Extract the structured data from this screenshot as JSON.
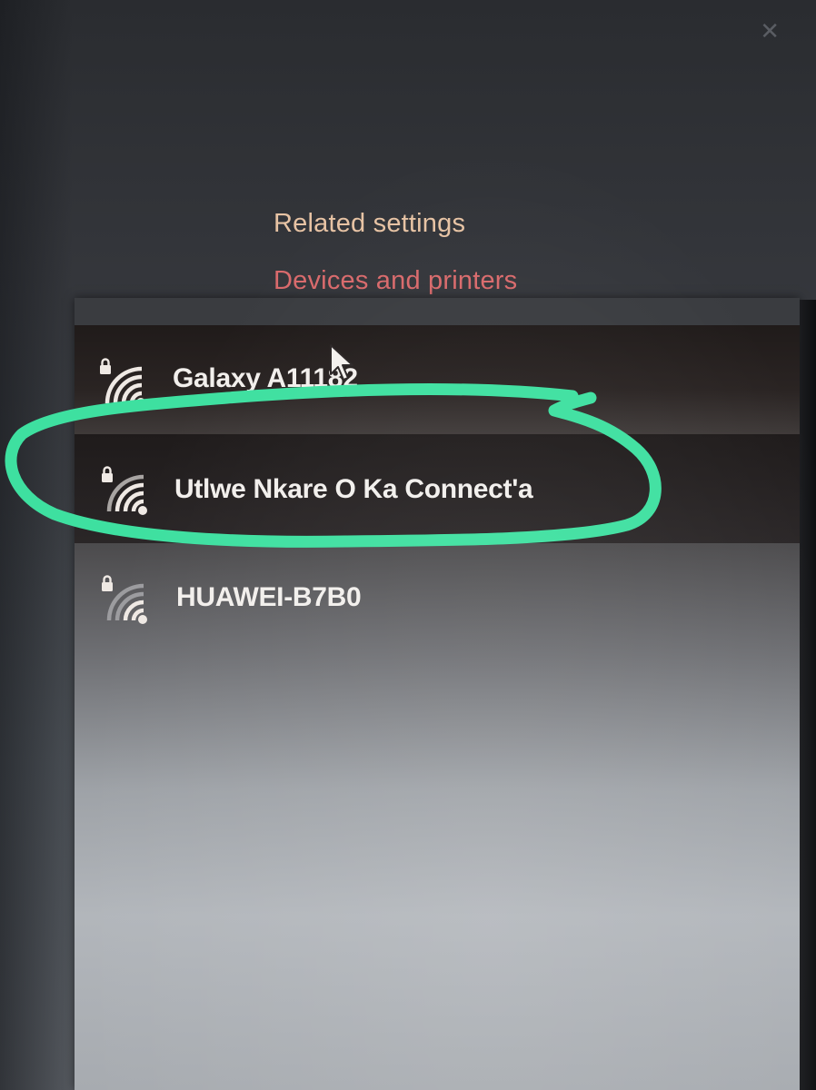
{
  "related_settings": {
    "heading": "Related settings",
    "devices_link": "Devices and printers"
  },
  "networks": [
    {
      "name": "Galaxy A111",
      "name_tail": "82",
      "secured": true,
      "icon": "wifi-signal-icon",
      "lock_icon": "lock-icon"
    },
    {
      "name": "Utlwe Nkare O Ka Connect'a",
      "secured": true,
      "icon": "wifi-signal-icon",
      "lock_icon": "lock-icon"
    },
    {
      "name": "HUAWEI-B7B0",
      "secured": true,
      "icon": "wifi-signal-icon",
      "lock_icon": "lock-icon"
    }
  ],
  "annotation": {
    "highlight_color": "#3ee0a0",
    "highlighted_network": "Utlwe Nkare O Ka Connect'a"
  },
  "colors": {
    "related_settings": "#e7c3a4",
    "devices_link": "#d96a6c",
    "network_text": "#f2efec"
  }
}
